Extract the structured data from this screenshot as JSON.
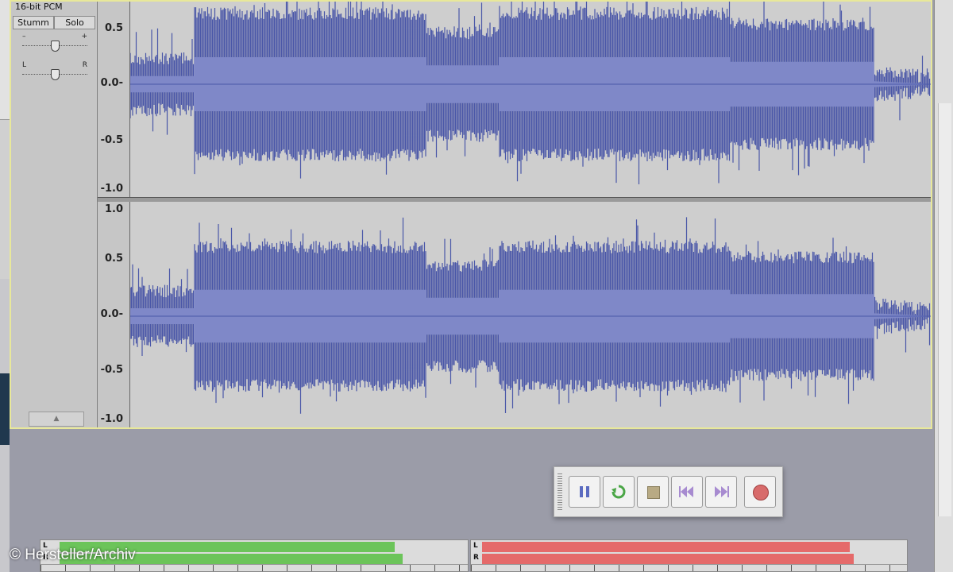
{
  "track": {
    "format_label": "16-bit PCM",
    "mute_label": "Stumm",
    "solo_label": "Solo",
    "gain_minus": "–",
    "gain_plus": "+",
    "pan_left": "L",
    "pan_right": "R",
    "gain_level": 0.5,
    "pan_level": 0.5
  },
  "channel_top": {
    "ticks": [
      "0.5",
      "0.0-",
      "-0.5",
      "-1.0"
    ]
  },
  "channel_bottom": {
    "ticks": [
      "1.0",
      "0.5",
      "0.0-",
      "-0.5",
      "-1.0"
    ]
  },
  "waveform": {
    "color_outer": "#4a57a8",
    "color_inner": "#7f88c8",
    "background": "#cecece",
    "sections": [
      {
        "start": 0.0,
        "end": 0.08,
        "amp": 0.18
      },
      {
        "start": 0.08,
        "end": 0.37,
        "amp": 0.6
      },
      {
        "start": 0.37,
        "end": 0.46,
        "amp": 0.42
      },
      {
        "start": 0.46,
        "end": 0.75,
        "amp": 0.6
      },
      {
        "start": 0.75,
        "end": 0.93,
        "amp": 0.5
      },
      {
        "start": 0.93,
        "end": 1.0,
        "amp": 0.0
      }
    ]
  },
  "transport": {
    "buttons": [
      {
        "name": "pause",
        "icon": "pause-icon"
      },
      {
        "name": "loop",
        "icon": "loop-icon"
      },
      {
        "name": "stop",
        "icon": "stop-icon"
      },
      {
        "name": "skip-start",
        "icon": "skip-start-icon"
      },
      {
        "name": "skip-end",
        "icon": "skip-end-icon"
      },
      {
        "name": "record",
        "icon": "record-icon"
      }
    ]
  },
  "meters": {
    "play": {
      "left": "L",
      "right": "R",
      "color": "#6cc45a",
      "level_l": 0.88,
      "level_r": 0.9
    },
    "record": {
      "left": "L",
      "right": "R",
      "color": "#e56a6a",
      "level_l": 0.89,
      "level_r": 0.9
    }
  },
  "credit": "© Hersteller/Archiv"
}
